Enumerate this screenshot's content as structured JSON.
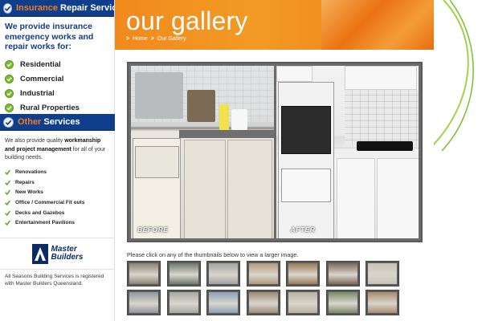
{
  "sidebar": {
    "insurance": {
      "title_highlight": "Insurance",
      "title_rest": " Repair Services",
      "emergency_text": "We provide insurance emergency works and repair works for:",
      "items": [
        "Residential",
        "Commercial",
        "Industrial",
        "Rural Properties"
      ]
    },
    "other": {
      "title_highlight": "Other",
      "title_rest": " Services",
      "desc_start": "We also provide quality ",
      "desc_bold": "workmanship and project management",
      "desc_end": " for all of your building needs.",
      "items": [
        "Renovations",
        "Repairs",
        "New Works",
        "Office / Commercial Fit outs",
        "Decks and Gazebos",
        "Entertainment Pavilions"
      ]
    },
    "master_builders": {
      "logo_line1": "Master",
      "logo_line2": "Builders",
      "note": "All Seasons Building Services is registered with Master Builders Queensland."
    }
  },
  "header": {
    "title": "our gallery",
    "breadcrumb": [
      "Home",
      "Our Gallery"
    ],
    "breadcrumb_sep": ">"
  },
  "gallery": {
    "before_label": "BEFORE",
    "after_label": "AFTER",
    "caption": "Please click on any of the thumbnails below to view a larger image.",
    "thumb_colors": [
      "#8c8272",
      "#6f7a6c",
      "#a3a3a3",
      "#b29a7a",
      "#9c7a58",
      "#7d6a56",
      "#c7c3b7",
      "#8e969c",
      "#a5a9a2",
      "#8aa0b8",
      "#9b8b78",
      "#b8b0a0",
      "#7a8a6a",
      "#a88a70"
    ]
  },
  "colors": {
    "brand_blue": "#0f3f8c",
    "brand_orange": "#f47920",
    "check_green": "#7bbd2f"
  }
}
